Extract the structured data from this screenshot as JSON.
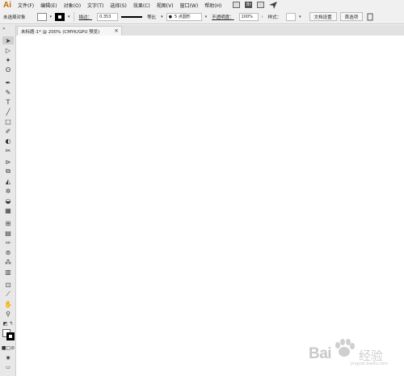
{
  "app": {
    "logo": "Ai"
  },
  "menu": [
    "文件(F)",
    "编辑(E)",
    "对象(O)",
    "文字(T)",
    "选择(S)",
    "效果(C)",
    "视图(V)",
    "窗口(W)",
    "帮助(H)"
  ],
  "menu_icons": {
    "br_label": "Br"
  },
  "control": {
    "no_selection": "未选择对象",
    "stroke_label": "描边：",
    "stroke_value": "0.353",
    "profile_label": "等比",
    "brush_label": "5 点圆形",
    "opacity_label": "不透明度：",
    "opacity_value": "100%",
    "style_label": "样式：",
    "doc_setup": "文档设置",
    "preferences": "首选项"
  },
  "tab": {
    "label": "未标题-1* @ 200% (CMYK/GPU 预览)",
    "close": "×"
  },
  "watermark": {
    "brand": "Bai",
    "brand2": "经验",
    "sub": "jingyan.baidu.com"
  },
  "colors": {
    "logo": "#c06a00",
    "canvas": "#ffffff",
    "chrome": "#f0f0f0"
  }
}
